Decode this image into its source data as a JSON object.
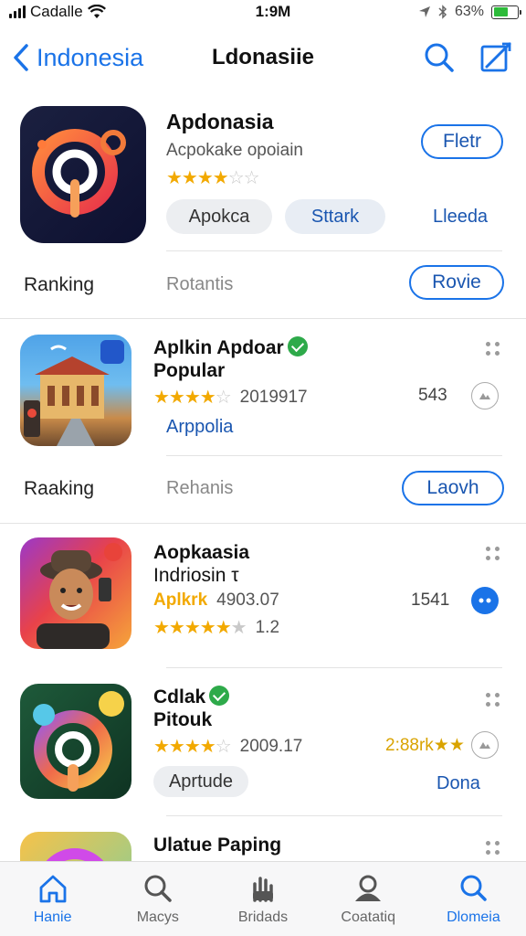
{
  "status": {
    "carrier": "Cadalle",
    "time": "1:9M",
    "battery": "63%"
  },
  "nav": {
    "back_label": "Indonesia",
    "title": "Ldonasiie"
  },
  "featured": {
    "title": "Apdonasia",
    "subtitle": "Acpokake opoiain",
    "rating": 3.5,
    "chip1": "Apokca",
    "chip2": "Sttark",
    "link": "Lleeda",
    "button": "Fletr"
  },
  "ranking1": {
    "label": "Ranking",
    "middle": "Rotantis",
    "button": "Rovie"
  },
  "ranking2": {
    "label": "Raaking",
    "middle": "Rehanis",
    "button": "Laovh"
  },
  "apps": [
    {
      "title_line1": "Aplkin Apdoar",
      "title_line2": "Popular",
      "verified": true,
      "rating": 4,
      "date": "2019917",
      "category": "Arppolia",
      "count": "543"
    },
    {
      "title_line1": "Aopkaasia",
      "title_line2": "Indriosin τ",
      "verified": false,
      "tag": "Aplkrk",
      "date": "4903.07",
      "rating2": 4.5,
      "score": "1.2",
      "count": "1541"
    },
    {
      "title_line1": "Cdlak",
      "title_line2": "Pitouk",
      "verified": true,
      "rating": 4,
      "date": "2009.17",
      "count": "2:88rk★★",
      "chip": "Aprtude",
      "link": "Dona"
    },
    {
      "title_line1": "Ulatue Paping"
    }
  ],
  "tabs": [
    {
      "label": "Hanie"
    },
    {
      "label": "Macys"
    },
    {
      "label": "Bridads"
    },
    {
      "label": "Coatatiq"
    },
    {
      "label": "Dlomeia"
    }
  ],
  "colors": {
    "accent": "#1a73e8",
    "star": "#f2a900",
    "verified": "#2eaa4a"
  }
}
